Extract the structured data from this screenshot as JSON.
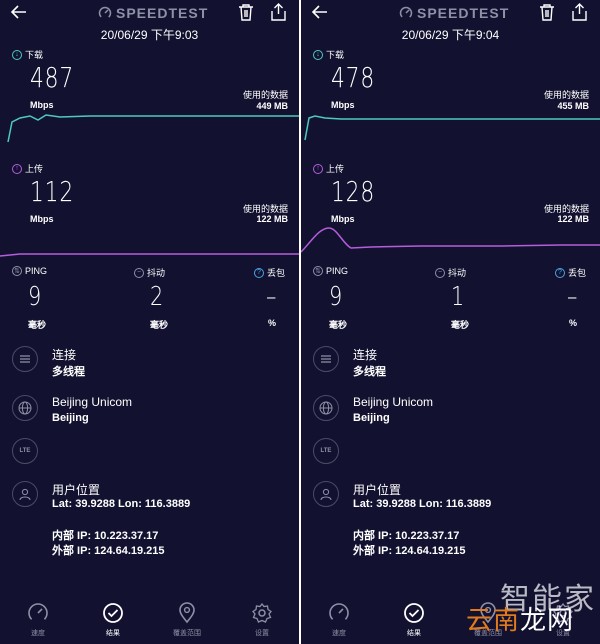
{
  "app": {
    "brand": "SPEEDTEST"
  },
  "colors": {
    "download": "#4fc9c0",
    "upload": "#b65ddc",
    "background": "#121230",
    "muted": "#8e90a6"
  },
  "labels": {
    "download": "下载",
    "upload": "上传",
    "mbps": "Mbps",
    "used_data": "使用的数据",
    "ping": "PING",
    "jitter": "抖动",
    "loss": "丢包",
    "ms": "毫秒",
    "percent": "%",
    "connections": "连接",
    "multi_thread": "多线程",
    "location": "用户位置",
    "lte": "LTE"
  },
  "results": [
    {
      "datetime": "20/06/29 下午9:03",
      "download": "487",
      "download_used": "449 MB",
      "upload": "112",
      "upload_used": "122 MB",
      "ping": "9",
      "jitter": "2",
      "loss": "–",
      "isp": "Beijing Unicom",
      "server": "Beijing",
      "latlon": "Lat: 39.9288 Lon: 116.3889",
      "internal_ip": "内部 IP: 10.223.37.17",
      "external_ip": "外部 IP: 124.64.19.215"
    },
    {
      "datetime": "20/06/29 下午9:04",
      "download": "478",
      "download_used": "455 MB",
      "upload": "128",
      "upload_used": "122 MB",
      "ping": "9",
      "jitter": "1",
      "loss": "–",
      "isp": "Beijing Unicom",
      "server": "Beijing",
      "latlon": "Lat: 39.9288 Lon: 116.3889",
      "internal_ip": "内部 IP: 10.223.37.17",
      "external_ip": "外部 IP: 124.64.19.215"
    }
  ],
  "nav": {
    "speed": "速度",
    "results": "结果",
    "coverage": "覆盖范围",
    "settings": "设置"
  },
  "watermark": {
    "line1": "智能家",
    "line2_a": "云南",
    "line2_b": "龙网"
  }
}
